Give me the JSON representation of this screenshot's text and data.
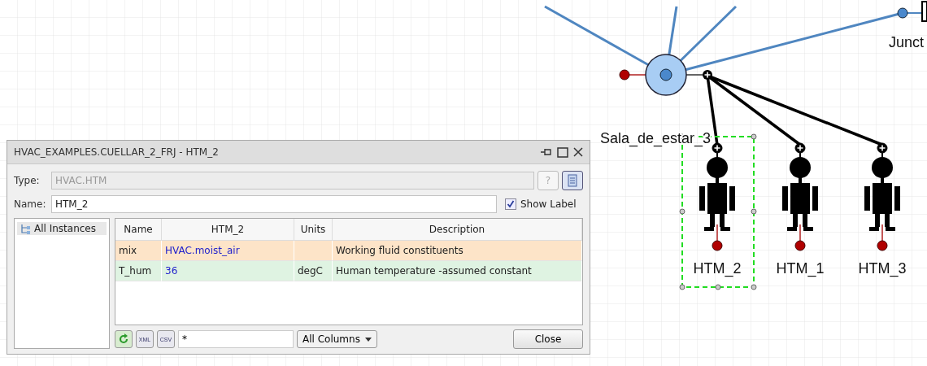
{
  "diagram": {
    "room": {
      "label": "Sala_de_estar_3"
    },
    "junction": {
      "label": "Junct"
    },
    "persons": [
      {
        "label": "HTM_2",
        "selected": true
      },
      {
        "label": "HTM_1",
        "selected": false
      },
      {
        "label": "HTM_3",
        "selected": false
      }
    ]
  },
  "dialog": {
    "title": "HVAC_EXAMPLES.CUELLAR_2_FRJ - HTM_2",
    "type_label": "Type:",
    "type_value": "HVAC.HTM",
    "name_label": "Name:",
    "name_value": "HTM_2",
    "help_button": "?",
    "show_label": {
      "label": "Show Label",
      "checked": true
    },
    "tree": [
      {
        "label": "All Instances",
        "selected": true
      }
    ],
    "table": {
      "columns": [
        "Name",
        "HTM_2",
        "Units",
        "Description"
      ],
      "rows": [
        {
          "cells": [
            "mix",
            "HVAC.moist_air",
            "",
            "Working fluid constituents"
          ],
          "color": "#fde4c8"
        },
        {
          "cells": [
            "T_hum",
            "36",
            "degC",
            "Human temperature -assumed constant"
          ],
          "color": "#dff3e2"
        }
      ]
    },
    "filter_value": "*",
    "columns_dropdown": "All Columns",
    "xml_button": "XML",
    "csv_button": "CSV",
    "close_button": "Close"
  }
}
